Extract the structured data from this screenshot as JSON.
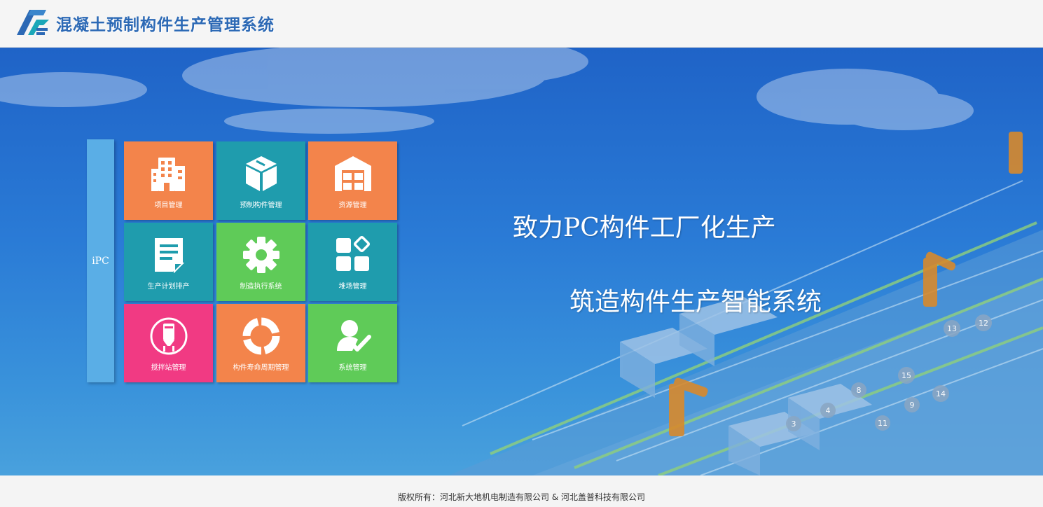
{
  "header": {
    "title": "混凝土预制构件生产管理系统",
    "logo_icon": "ipc-logo"
  },
  "sidebar": {
    "label": "iPC"
  },
  "tiles": [
    {
      "label": "项目管理",
      "color": "#f3844b",
      "icon": "building-icon"
    },
    {
      "label": "预制构件管理",
      "color": "#1f9cad",
      "icon": "box-icon"
    },
    {
      "label": "资源管理",
      "color": "#f3844b",
      "icon": "warehouse-icon"
    },
    {
      "label": "生产计划排产",
      "color": "#1f9cad",
      "icon": "document-icon"
    },
    {
      "label": "制造执行系统",
      "color": "#5fcb58",
      "icon": "gear-icon"
    },
    {
      "label": "堆场管理",
      "color": "#1f9cad",
      "icon": "grid-blocks-icon"
    },
    {
      "label": "搅拌站管理",
      "color": "#f13a83",
      "icon": "silo-icon"
    },
    {
      "label": "构件寿命周期管理",
      "color": "#f3844b",
      "icon": "cycle-ring-icon"
    },
    {
      "label": "系统管理",
      "color": "#5fcb58",
      "icon": "user-check-icon"
    }
  ],
  "hero": {
    "slogan_line1": "致力PC构件工厂化生产",
    "slogan_line2": "筑造构件生产智能系统",
    "station_numbers": [
      "3",
      "4",
      "8",
      "9",
      "11",
      "12",
      "13",
      "14",
      "15"
    ]
  },
  "footer": {
    "copyright": "版权所有：河北新大地机电制造有限公司 & 河北盖普科技有限公司"
  }
}
